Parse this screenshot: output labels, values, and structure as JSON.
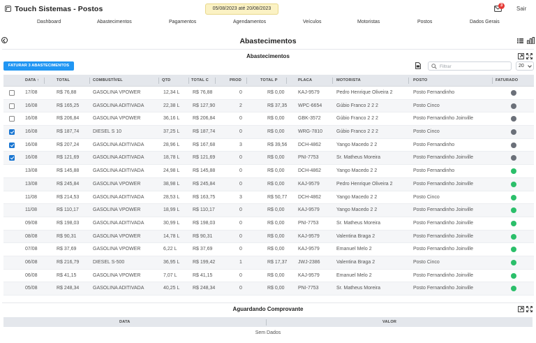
{
  "app": {
    "title": "Touch Sistemas - Postos",
    "date_range": "05/08/2023 até 20/08/2023",
    "notifications": "3",
    "logout": "Sair"
  },
  "nav": [
    "Dashboard",
    "Abastecimentos",
    "Pagamentos",
    "Agendamentos",
    "Veículos",
    "Motoristas",
    "Postos",
    "Dados Gerais"
  ],
  "page": {
    "title": "Abastecimentos"
  },
  "table_card": {
    "title": "Abastecimentos",
    "faturar_label": "FATURAR 3 ABASTECIMENTOS",
    "filter_placeholder": "Filtrar",
    "page_size": "20",
    "columns": [
      "DATA",
      "TOTAL",
      "COMBUSTÍVEL",
      "QTD",
      "TOTAL C",
      "PROD",
      "TOTAL P",
      "PLACA",
      "MOTORISTA",
      "POSTO",
      "FATURADO"
    ],
    "rows": [
      {
        "checkbox": true,
        "checked": false,
        "data": "17/08",
        "total": "R$ 76,88",
        "combustivel": "GASOLINA VPOWER",
        "qtd": "12,34 L",
        "total_c": "R$ 76,88",
        "prod": "0",
        "total_p": "R$ 0,00",
        "placa": "KAJ-9579",
        "motorista": "Pedro Henrique Oliveira 2",
        "posto": "Posto Fernandinho",
        "faturado": false
      },
      {
        "checkbox": true,
        "checked": false,
        "data": "16/08",
        "total": "R$ 165,25",
        "combustivel": "GASOLINA ADITIVADA",
        "qtd": "22,38 L",
        "total_c": "R$ 127,90",
        "prod": "2",
        "total_p": "R$ 37,35",
        "placa": "WPC-6654",
        "motorista": "Gúbio Franco 2 2 2",
        "posto": "Posto Cinco",
        "faturado": false
      },
      {
        "checkbox": true,
        "checked": false,
        "data": "16/08",
        "total": "R$ 206,84",
        "combustivel": "GASOLINA VPOWER",
        "qtd": "36,16 L",
        "total_c": "R$ 206,84",
        "prod": "0",
        "total_p": "R$ 0,00",
        "placa": "GBK-3572",
        "motorista": "Gúbio Franco 2 2 2",
        "posto": "Posto Fernandinho Joinville",
        "faturado": false
      },
      {
        "checkbox": true,
        "checked": true,
        "data": "16/08",
        "total": "R$ 187,74",
        "combustivel": "DIESEL S 10",
        "qtd": "37,25 L",
        "total_c": "R$ 187,74",
        "prod": "0",
        "total_p": "R$ 0,00",
        "placa": "WRG-7810",
        "motorista": "Gúbio Franco 2 2 2",
        "posto": "Posto Cinco",
        "faturado": false
      },
      {
        "checkbox": true,
        "checked": true,
        "data": "16/08",
        "total": "R$ 207,24",
        "combustivel": "GASOLINA ADITIVADA",
        "qtd": "28,96 L",
        "total_c": "R$ 167,68",
        "prod": "3",
        "total_p": "R$ 39,56",
        "placa": "DCH-4862",
        "motorista": "Yango Macedo 2 2",
        "posto": "Posto Fernandinho",
        "faturado": false
      },
      {
        "checkbox": true,
        "checked": true,
        "data": "16/08",
        "total": "R$ 121,69",
        "combustivel": "GASOLINA ADITIVADA",
        "qtd": "18,78 L",
        "total_c": "R$ 121,69",
        "prod": "0",
        "total_p": "R$ 0,00",
        "placa": "PNI-7753",
        "motorista": "Sr. Matheus Moreira",
        "posto": "Posto Fernandinho Joinville",
        "faturado": false
      },
      {
        "checkbox": false,
        "checked": false,
        "data": "13/08",
        "total": "R$ 145,88",
        "combustivel": "GASOLINA ADITIVADA",
        "qtd": "24,98 L",
        "total_c": "R$ 145,88",
        "prod": "0",
        "total_p": "R$ 0,00",
        "placa": "DCH-4862",
        "motorista": "Yango Macedo 2 2",
        "posto": "Posto Fernandinho",
        "faturado": true
      },
      {
        "checkbox": false,
        "checked": false,
        "data": "13/08",
        "total": "R$ 245,84",
        "combustivel": "GASOLINA VPOWER",
        "qtd": "38,98 L",
        "total_c": "R$ 245,84",
        "prod": "0",
        "total_p": "R$ 0,00",
        "placa": "KAJ-9579",
        "motorista": "Pedro Henrique Oliveira 2",
        "posto": "Posto Fernandinho Joinville",
        "faturado": true
      },
      {
        "checkbox": false,
        "checked": false,
        "data": "11/08",
        "total": "R$ 214,53",
        "combustivel": "GASOLINA ADITIVADA",
        "qtd": "28,53 L",
        "total_c": "R$ 163,75",
        "prod": "3",
        "total_p": "R$ 50,77",
        "placa": "DCH-4862",
        "motorista": "Yango Macedo 2 2",
        "posto": "Posto Cinco",
        "faturado": true
      },
      {
        "checkbox": false,
        "checked": false,
        "data": "11/08",
        "total": "R$ 110,17",
        "combustivel": "GASOLINA VPOWER",
        "qtd": "18,99 L",
        "total_c": "R$ 110,17",
        "prod": "0",
        "total_p": "R$ 0,00",
        "placa": "KAJ-9579",
        "motorista": "Yango Macedo 2 2",
        "posto": "Posto Fernandinho Joinville",
        "faturado": true
      },
      {
        "checkbox": false,
        "checked": false,
        "data": "09/08",
        "total": "R$ 198,03",
        "combustivel": "GASOLINA ADITIVADA",
        "qtd": "30,99 L",
        "total_c": "R$ 198,03",
        "prod": "0",
        "total_p": "R$ 0,00",
        "placa": "PNI-7753",
        "motorista": "Sr. Matheus Moreira",
        "posto": "Posto Fernandinho Joinville",
        "faturado": true
      },
      {
        "checkbox": false,
        "checked": false,
        "data": "08/08",
        "total": "R$ 90,31",
        "combustivel": "GASOLINA VPOWER",
        "qtd": "14,78 L",
        "total_c": "R$ 90,31",
        "prod": "0",
        "total_p": "R$ 0,00",
        "placa": "KAJ-9579",
        "motorista": "Valentina Braga 2",
        "posto": "Posto Fernandinho Joinville",
        "faturado": true
      },
      {
        "checkbox": false,
        "checked": false,
        "data": "07/08",
        "total": "R$ 37,69",
        "combustivel": "GASOLINA VPOWER",
        "qtd": "6,22 L",
        "total_c": "R$ 37,69",
        "prod": "0",
        "total_p": "R$ 0,00",
        "placa": "KAJ-9579",
        "motorista": "Emanuel Melo 2",
        "posto": "Posto Fernandinho Joinville",
        "faturado": true
      },
      {
        "checkbox": false,
        "checked": false,
        "data": "06/08",
        "total": "R$ 216,79",
        "combustivel": "DIESEL S-500",
        "qtd": "36,95 L",
        "total_c": "R$ 199,42",
        "prod": "1",
        "total_p": "R$ 17,37",
        "placa": "JWJ-2386",
        "motorista": "Valentina Braga 2",
        "posto": "Posto Cinco",
        "faturado": true
      },
      {
        "checkbox": false,
        "checked": false,
        "data": "06/08",
        "total": "R$ 41,15",
        "combustivel": "GASOLINA VPOWER",
        "qtd": "7,07 L",
        "total_c": "R$ 41,15",
        "prod": "0",
        "total_p": "R$ 0,00",
        "placa": "KAJ-9579",
        "motorista": "Emanuel Melo 2",
        "posto": "Posto Fernandinho Joinville",
        "faturado": true
      },
      {
        "checkbox": false,
        "checked": false,
        "data": "05/08",
        "total": "R$ 248,34",
        "combustivel": "GASOLINA ADITIVADA",
        "qtd": "40,25 L",
        "total_c": "R$ 248,34",
        "prod": "0",
        "total_p": "R$ 0,00",
        "placa": "PNI-7753",
        "motorista": "Sr. Matheus Moreira",
        "posto": "Posto Fernandinho Joinville",
        "faturado": true
      }
    ]
  },
  "receipt_card": {
    "title": "Aguardando Comprovante",
    "columns": [
      "DATA",
      "VALOR"
    ],
    "empty": "Sem Dados"
  },
  "colors": {
    "faturado_yes": "#2bbf6a",
    "faturado_no": "#6b7079",
    "accent": "#2196f3",
    "checkbox_checked": "#1976d2",
    "date_badge": "#fbf2c4"
  }
}
